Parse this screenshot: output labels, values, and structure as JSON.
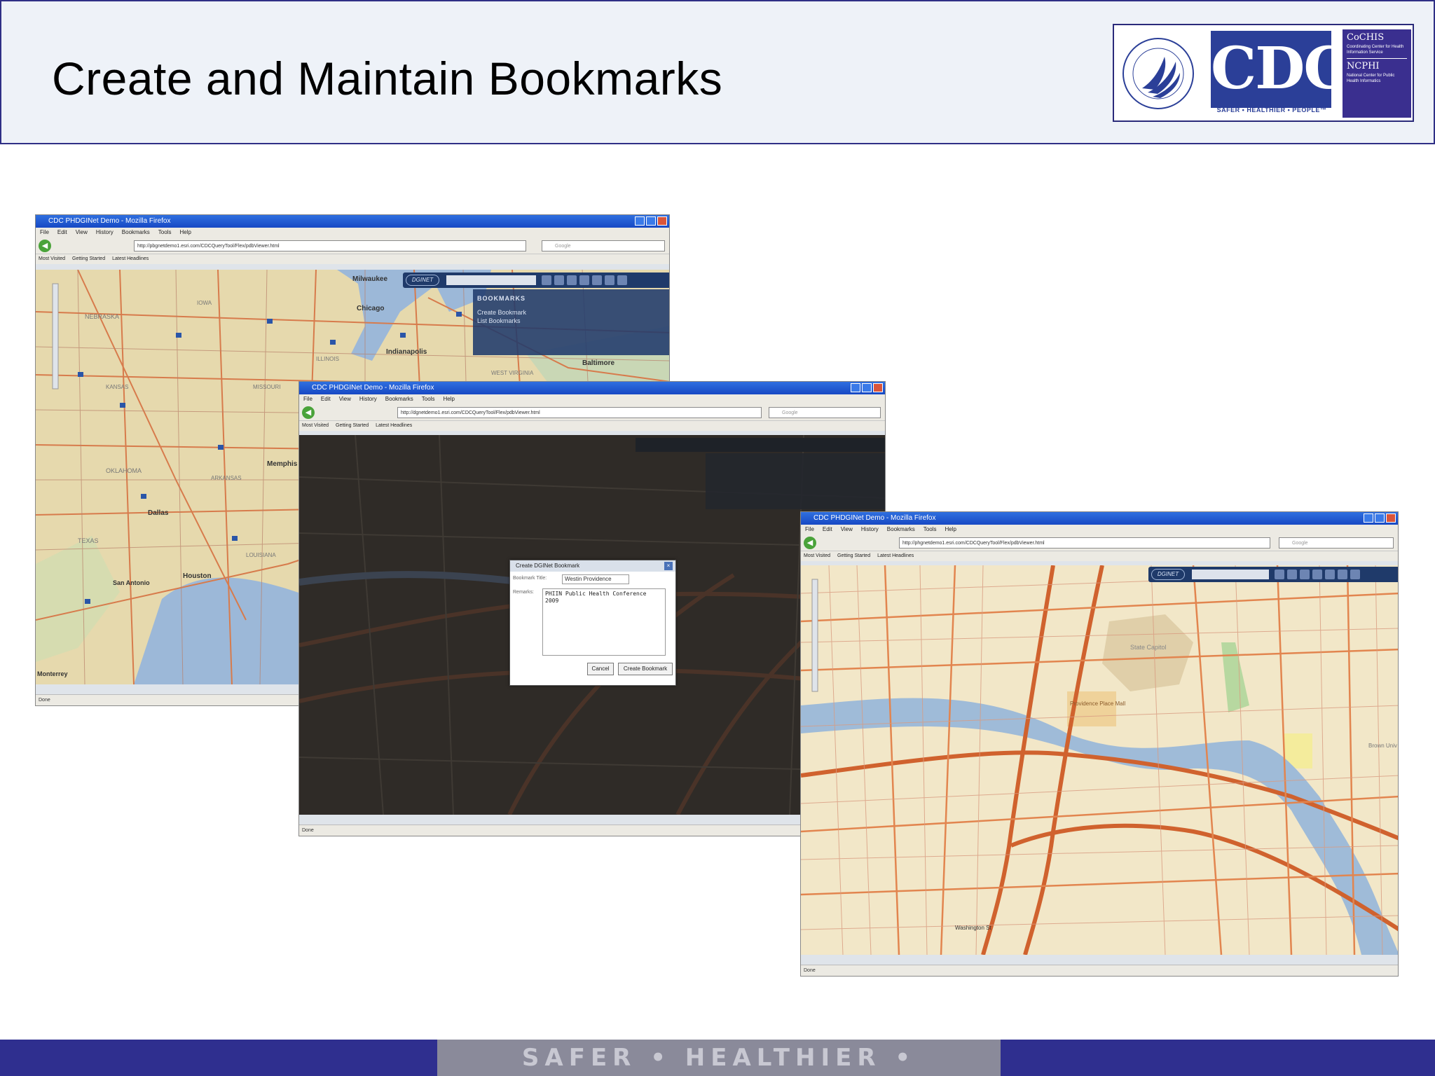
{
  "slide": {
    "title": "Create and Maintain Bookmarks",
    "footer_banner": "SAFER • HEALTHIER • PEOPLE™"
  },
  "logo": {
    "cdc": "CDC",
    "tagline": "SAFER • HEALTHIER • PEOPLE™",
    "coches_abbr": "CoCHIS",
    "coches_desc": "Coordinating Center for Health Information Service",
    "ncphi_abbr": "NCPHI",
    "ncphi_desc": "National Center for Public Health Informatics"
  },
  "browser": {
    "title": "CDC PHDGINet Demo - Mozilla Firefox",
    "menu": [
      "File",
      "Edit",
      "View",
      "History",
      "Bookmarks",
      "Tools",
      "Help"
    ],
    "bookmarks_bar": [
      "Most Visited",
      "Getting Started",
      "Latest Headlines"
    ],
    "search_placeholder": "Google",
    "status": "Done",
    "url1": "http://pbgnetdemo1.esri.com/CDCQueryTool/Flex/pdbViewer.html",
    "url2": "http://dgnetdemo1.esri.com/CDCQueryTool/Flex/pdbViewer.html",
    "url3": "http://phgnetdemo1.esri.com/CDCQueryTool/Flex/pdbViewer.html"
  },
  "map_toolbar": {
    "logo": "DGINET"
  },
  "bookmarks_panel": {
    "heading": "BOOKMARKS",
    "items": [
      "Create Bookmark",
      "List Bookmarks"
    ]
  },
  "map1_labels": [
    "Milwaukee",
    "Chicago",
    "IOWA",
    "NEBRASKA",
    "KANSAS",
    "MISSOURI",
    "ILLINOIS",
    "Indianapolis",
    "Baltimore",
    "WEST VIRGINIA",
    "OKLAHOMA",
    "ARKANSAS",
    "Memphis",
    "TEXAS",
    "Dallas",
    "LOUISIANA",
    "Houston",
    "San Antonio",
    "Monterrey"
  ],
  "map3_labels": [
    "State Capitol",
    "Providence Place Mall",
    "Washington St",
    "Brown Univ"
  ],
  "dialog": {
    "title": "Create DGINet Bookmark",
    "title_label": "Bookmark Title:",
    "title_value": "Westin Providence",
    "remarks_label": "Remarks:",
    "remarks_value": "PHIIN Public Health Conference 2009",
    "cancel": "Cancel",
    "create": "Create Bookmark"
  },
  "colors": {
    "header_bg": "#eef2f8",
    "header_border": "#2f2f86",
    "footer_bg": "#2f2f8f",
    "cdc_blue": "#2b3f98"
  }
}
